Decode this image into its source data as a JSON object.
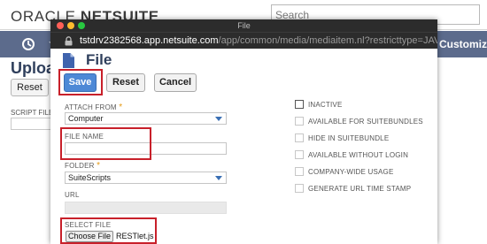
{
  "background": {
    "logo": {
      "oracle": "ORACLE",
      "netsuite": "NETSUITE"
    },
    "search_placeholder": "Search",
    "nav": {
      "customize": "Customiz"
    },
    "page_title": "Upload",
    "reset_label": "Reset",
    "script_file_label": "SCRIPT FILE",
    "required_star": "*"
  },
  "popup": {
    "window_title": "File",
    "url_host": "tstdrv2382568.app.netsuite.com",
    "url_path": "/app/common/media/mediaitem.nl?restricttype=JAVA...",
    "title": "File",
    "buttons": {
      "save": "Save",
      "reset": "Reset",
      "cancel": "Cancel"
    },
    "fields": {
      "attach_from": {
        "label": "ATTACH FROM",
        "value": "Computer"
      },
      "file_name": {
        "label": "FILE NAME",
        "value": ""
      },
      "folder": {
        "label": "FOLDER",
        "value": "SuiteScripts"
      },
      "url": {
        "label": "URL",
        "value": ""
      },
      "select_file": {
        "label": "SELECT FILE",
        "button": "Choose File",
        "chosen": "RESTlet.js"
      }
    },
    "required_star": "*",
    "checkboxes": [
      {
        "label": "INACTIVE",
        "checked": false,
        "enabled": true
      },
      {
        "label": "AVAILABLE FOR SUITEBUNDLES",
        "checked": false,
        "enabled": false
      },
      {
        "label": "HIDE IN SUITEBUNDLE",
        "checked": false,
        "enabled": false
      },
      {
        "label": "AVAILABLE WITHOUT LOGIN",
        "checked": false,
        "enabled": false
      },
      {
        "label": "COMPANY-WIDE USAGE",
        "checked": false,
        "enabled": false
      },
      {
        "label": "GENERATE URL TIME STAMP",
        "checked": false,
        "enabled": false
      }
    ]
  },
  "colors": {
    "nav_bar": "#5c6b8c",
    "title_blue": "#2f3f5c",
    "save_button": "#4d89d6",
    "highlight": "#c8202a",
    "required_star": "#e59a17",
    "window_chrome": "#2c2c2c",
    "traffic_close": "#ff5f57",
    "traffic_min": "#febc2e",
    "traffic_max": "#28c840"
  },
  "icons": {
    "nav": [
      "recent-records-icon",
      "star-icon"
    ],
    "page": "file-icon",
    "lock": "lock-icon"
  }
}
